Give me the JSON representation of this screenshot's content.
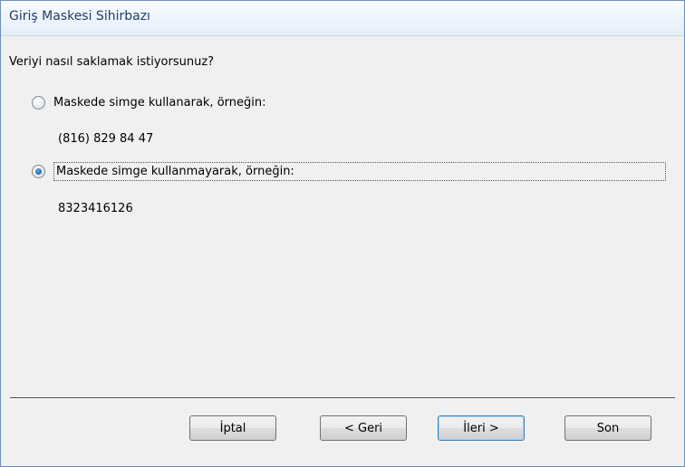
{
  "window": {
    "title": "Giriş Maskesi Sihirbazı"
  },
  "question": "Veriyi nasıl saklamak istiyorsunuz?",
  "options": [
    {
      "label": "Maskede simge kullanarak, örneğin:",
      "example": "(816) 829 84 47",
      "selected": false
    },
    {
      "label": "Maskede simge kullanmayarak, örneğin:",
      "example": "8323416126",
      "selected": true
    }
  ],
  "buttons": {
    "cancel": "İptal",
    "back": "< Geri",
    "next": "İleri >",
    "finish": "Son"
  }
}
